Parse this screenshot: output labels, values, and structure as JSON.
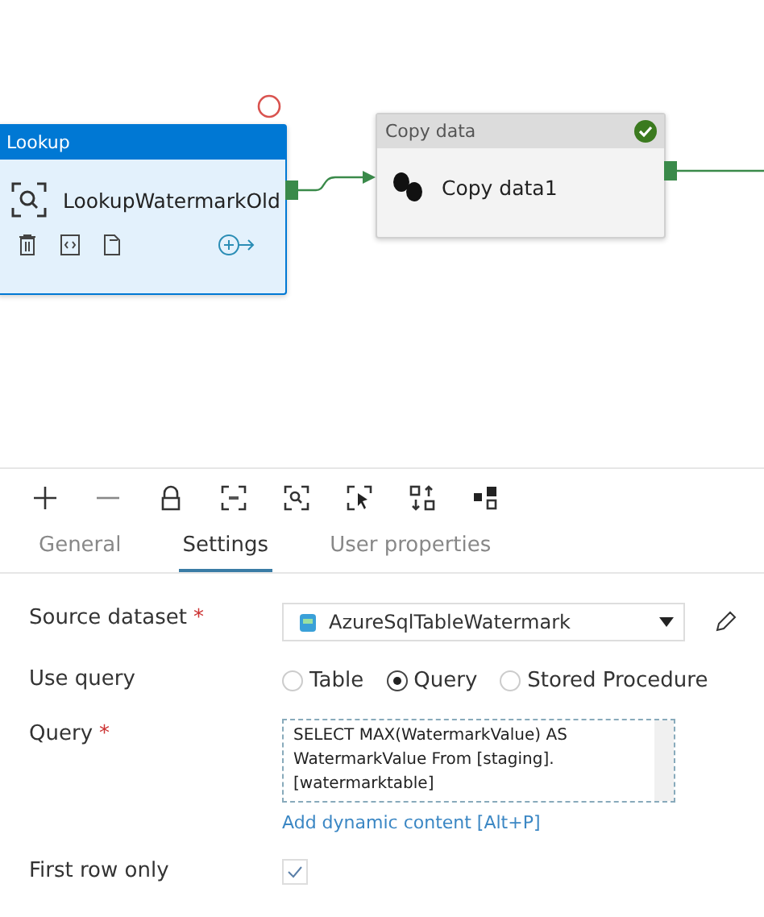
{
  "canvas": {
    "nodes": [
      {
        "kind": "lookup",
        "title": "Lookup",
        "name": "LookupWatermarkOld",
        "selected": true
      },
      {
        "kind": "copy",
        "title": "Copy data",
        "name": "Copy data1",
        "selected": false,
        "succeeded": true
      }
    ]
  },
  "tabs": [
    {
      "label": "General",
      "selected": false
    },
    {
      "label": "Settings",
      "selected": true
    },
    {
      "label": "User properties",
      "selected": false
    }
  ],
  "form": {
    "source_dataset": {
      "label": "Source dataset",
      "required": "*",
      "value": "AzureSqlTableWatermark"
    },
    "use_query": {
      "label": "Use query",
      "options": [
        {
          "label": "Table",
          "selected": false
        },
        {
          "label": "Query",
          "selected": true
        },
        {
          "label": "Stored Procedure",
          "selected": false
        }
      ]
    },
    "query": {
      "label": "Query",
      "required": "*",
      "value": "SELECT MAX(WatermarkValue) AS WatermarkValue From [staging].[watermarktable]",
      "link": "Add dynamic content [Alt+P]"
    },
    "first_row_only": {
      "label": "First row only",
      "checked": true
    }
  }
}
